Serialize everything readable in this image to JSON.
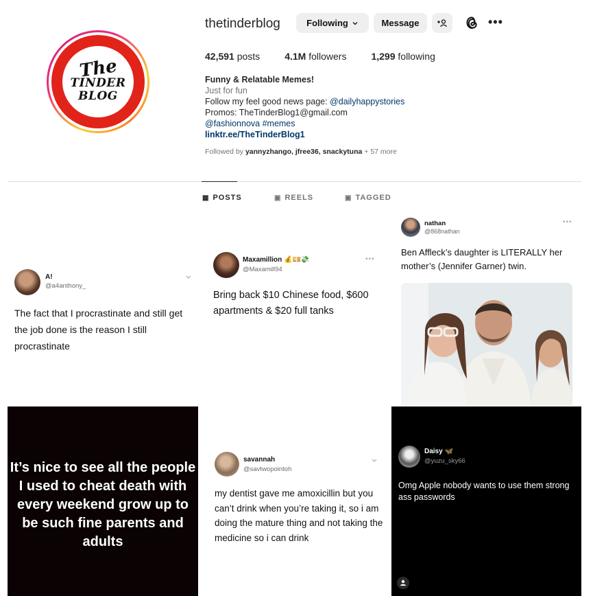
{
  "profile": {
    "username": "thetinderblog",
    "following_label": "Following",
    "message_label": "Message",
    "add_user_icon": "+⚇",
    "more_icon": "•••",
    "logo": {
      "line1": "The",
      "line2": "TINDER",
      "line3": "BLOG"
    }
  },
  "stats": {
    "posts_count": "42,591",
    "posts_label": "posts",
    "followers_count": "4.1M",
    "followers_label": "followers",
    "following_count": "1,299",
    "following_label": "following"
  },
  "bio": {
    "title": "Funny & Relatable Memes!",
    "category": "Just for fun",
    "line1_prefix": "Follow my feel good news page: ",
    "line1_mention": "@dailyhappystories",
    "line2": "Promos: TheTinderBlog1@gmail.com",
    "line3_mention": "@fashionnova",
    "line3_tag": " #memes",
    "link": "linktr.ee/TheTinderBlog1",
    "followed_prefix": "Followed by ",
    "followed_names": "yannyzhango, jfree36, snackytuna",
    "followed_suffix": " + 57 more"
  },
  "tabs": [
    {
      "label": "POSTS",
      "icon": "▦"
    },
    {
      "label": "REELS",
      "icon": "▣"
    },
    {
      "label": "TAGGED",
      "icon": "▣"
    }
  ],
  "posts": {
    "p1": {
      "name": "A!",
      "handle": "@a4anthony_",
      "text": "The fact that I procrastinate and still get the job done is the reason I still procrastinate"
    },
    "p2": {
      "name": "Maxamillion 💰💴💸",
      "handle": "@Maxamill94",
      "text": "Bring back $10 Chinese food, $600 apartments & $20 full tanks"
    },
    "p3": {
      "name": "nathan",
      "handle": "@868nathan",
      "text": "Ben Affleck’s daughter is LITERALLY her mother’s (Jennifer Garner) twin."
    },
    "p4": {
      "text": "It’s nice to see all the people I used to cheat death with every weekend grow up to be such fine parents and adults"
    },
    "p5": {
      "name": "savannah",
      "handle": "@savtwopointoh",
      "text": "my dentist gave me amoxicillin but you can’t drink when you’re taking it, so i am doing the mature thing and not taking the medicine so i can drink"
    },
    "p6": {
      "name": "Daisy 🦋",
      "handle": "@yuzu_sky66",
      "text": "Omg Apple nobody wants to use them strong ass passwords"
    }
  }
}
